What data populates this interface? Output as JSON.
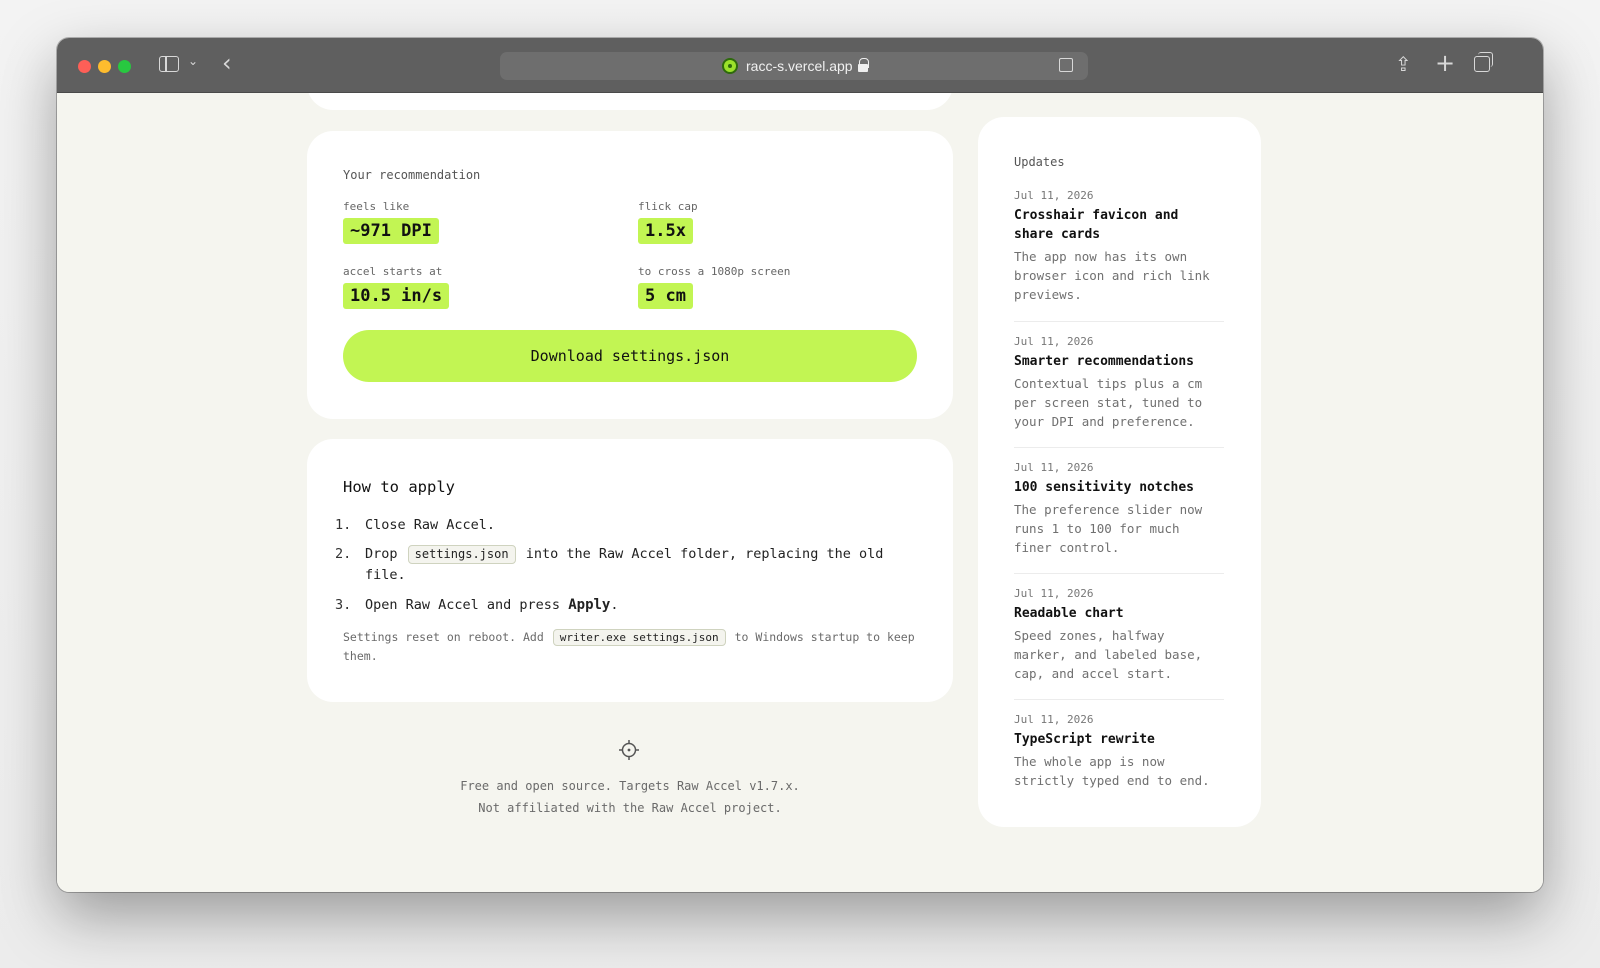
{
  "browser": {
    "url": "racc-s.vercel.app"
  },
  "recommendation": {
    "title": "Your recommendation",
    "stats": [
      {
        "label": "feels like",
        "value": "~971 DPI"
      },
      {
        "label": "flick cap",
        "value": "1.5x"
      },
      {
        "label": "accel starts at",
        "value": "10.5 in/s"
      },
      {
        "label": "to cross a 1080p screen",
        "value": "5 cm"
      }
    ],
    "download_label": "Download settings.json"
  },
  "apply": {
    "title": "How to apply",
    "step1": {
      "num": "1.",
      "text": "Close Raw Accel."
    },
    "step2": {
      "num": "2.",
      "pre": "Drop",
      "code": "settings.json",
      "post": "into the Raw Accel folder, replacing the old file."
    },
    "step3": {
      "num": "3.",
      "pre": "Open Raw Accel and press",
      "bold": "Apply",
      "post": "."
    },
    "note": {
      "pre": "Settings reset on reboot. Add",
      "code": "writer.exe settings.json",
      "post": "to Windows startup to keep them."
    }
  },
  "footer": {
    "line1": "Free and open source. Targets Raw Accel v1.7.x.",
    "line2": "Not affiliated with the Raw Accel project."
  },
  "updates": {
    "heading": "Updates",
    "items": [
      {
        "date": "Jul 11, 2026",
        "title": "Crosshair favicon and share cards",
        "desc": "The app now has its own browser icon and rich link previews."
      },
      {
        "date": "Jul 11, 2026",
        "title": "Smarter recommendations",
        "desc": "Contextual tips plus a cm per screen stat, tuned to your DPI and preference."
      },
      {
        "date": "Jul 11, 2026",
        "title": "100 sensitivity notches",
        "desc": "The preference slider now runs 1 to 100 for much finer control."
      },
      {
        "date": "Jul 11, 2026",
        "title": "Readable chart",
        "desc": "Speed zones, halfway marker, and labeled base, cap, and accel start."
      },
      {
        "date": "Jul 11, 2026",
        "title": "TypeScript rewrite",
        "desc": "The whole app is now strictly typed end to end."
      }
    ]
  },
  "colors": {
    "accent": "#c2f553",
    "page_bg": "#f5f5ef",
    "card_bg": "#ffffff"
  }
}
